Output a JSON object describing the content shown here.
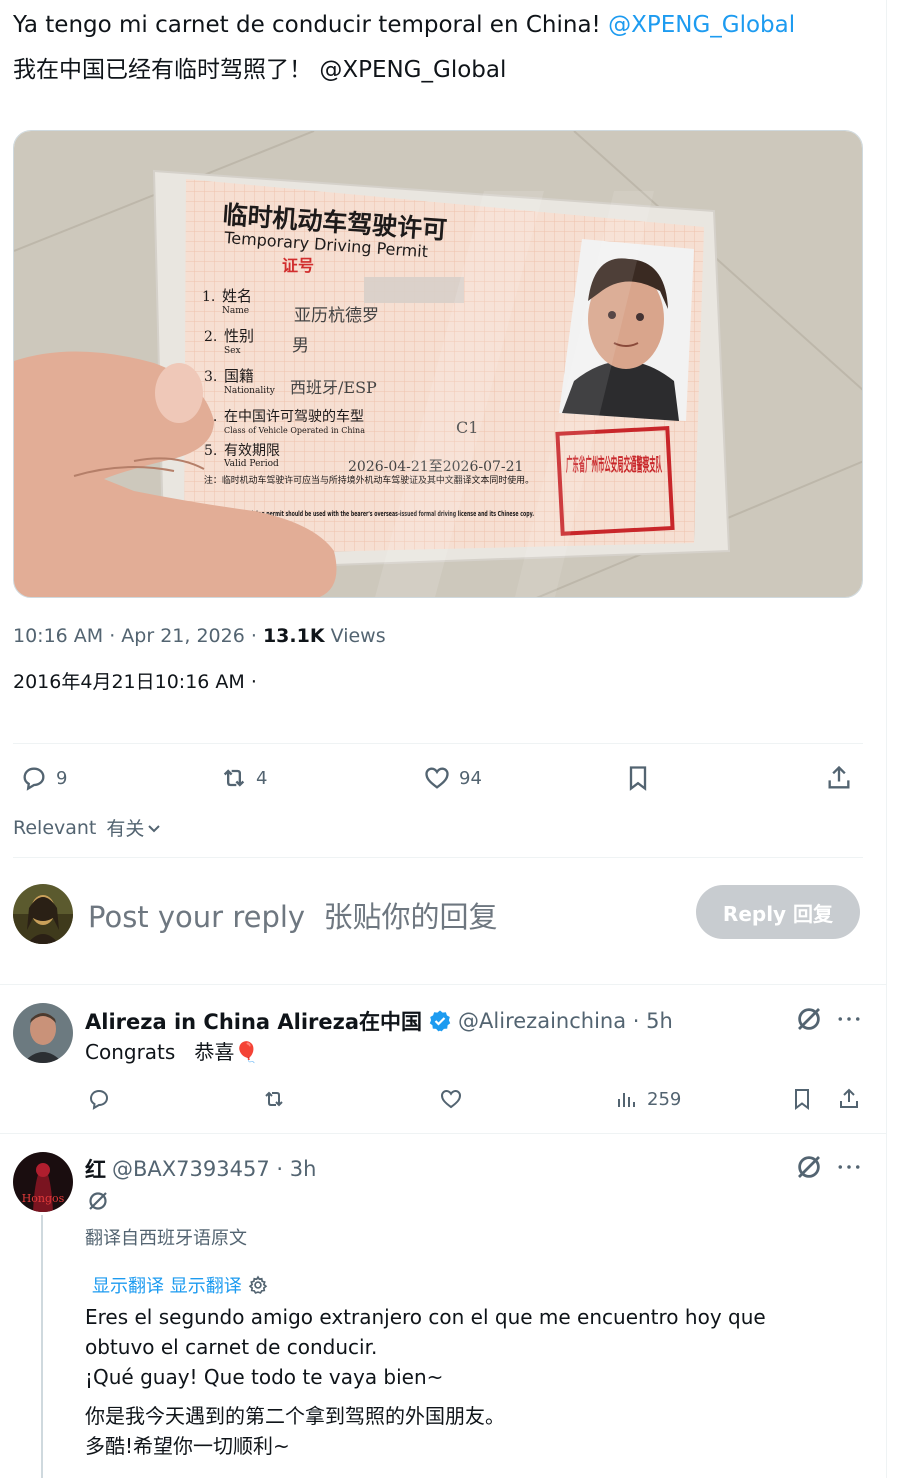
{
  "tweet": {
    "text_es": "Ya tengo mi carnet de conducir temporal en China!",
    "mention": "@XPENG_Global",
    "text_zh": "我在中国已经有临时驾照了！",
    "mention_zh": "@XPENG_Global",
    "timestamp": "10:16 AM · Apr 21, 2026 ·",
    "views_count": "13.1K",
    "views_label": "Views",
    "timestamp_zh": "2016年4月21日10:16 AM ·",
    "replies": "9",
    "retweets": "4",
    "likes": "94"
  },
  "permit": {
    "title_zh": "临时机动车驾驶许可",
    "title_en": "Temporary Driving Permit",
    "cert_no_label": "证号",
    "f1_num": "1.",
    "f1_zh": "姓名",
    "f1_en": "Name",
    "f1_value": "亚历杭德罗",
    "f2_num": "2.",
    "f2_zh": "性别",
    "f2_en": "Sex",
    "f2_value": "男",
    "f3_num": "3.",
    "f3_zh": "国籍",
    "f3_en": "Nationality",
    "f3_value": "西班牙/ESP",
    "f4_num": "4.",
    "f4_zh": "在中国许可驾驶的车型",
    "f4_en": "Class of Vehicle Operated in China",
    "f4_value": "C1",
    "f5_num": "5.",
    "f5_zh": "有效期限",
    "f5_en": "Valid Period",
    "f5_value": "2026-04-21至2026-07-21",
    "note_zh": "注：临时机动车驾驶许可应当与所持境外机动车驾驶证及其中文翻译文本同时使用。",
    "note_en": "This temporary driving permit should be used with the bearer's overseas-issued formal driving license and its Chinese copy.",
    "stamp_text": "广东省广州市公安局交通警察支队"
  },
  "filter": {
    "label": "Relevant",
    "label_zh": "有关"
  },
  "composer": {
    "placeholder": "Post your reply",
    "placeholder_zh": "张贴你的回复",
    "button_label": "Reply 回复"
  },
  "reply1": {
    "name": "Alireza in China Alireza在中国",
    "handle": "@Alirezainchina · 5h",
    "text": "Congrats",
    "text_zh": "恭喜🎈",
    "views": "259"
  },
  "reply2": {
    "name": "红",
    "handle": "@BAX7393457 · 3h",
    "avatar_label": "Hongos",
    "translated_from": "翻译自西班牙语原文",
    "show_translation": "显示翻译 显示翻译",
    "line1": "Eres el segundo amigo extranjero con el que me encuentro hoy que",
    "line2": "obtuvo el carnet de conducir.",
    "line3": "¡Qué guay! Que todo te vaya bien~",
    "line4": "你是我今天遇到的第二个拿到驾照的外国朋友。",
    "line5": "多酷!希望你一切顺利~"
  },
  "colors": {
    "accent": "#1d9bf0",
    "muted": "#536471",
    "text": "#0f1419",
    "divider": "#eff3f4",
    "stamp": "#c8262a"
  }
}
